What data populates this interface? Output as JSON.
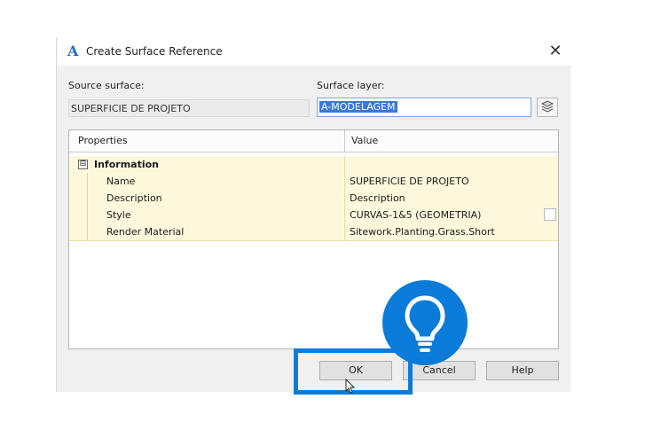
{
  "dialog": {
    "title": "Create Surface Reference",
    "app_icon": "autocad-civil3d-icon",
    "close_glyph": "✕"
  },
  "source_surface": {
    "label": "Source surface:",
    "value": "SUPERFICIE DE PROJETO"
  },
  "surface_layer": {
    "label": "Surface layer:",
    "value": "A-MODELAGEM",
    "button_icon": "layers-icon"
  },
  "properties_grid": {
    "headers": [
      "Properties",
      "Value"
    ],
    "category": {
      "name": "Information",
      "toggle": "⊟"
    },
    "rows": [
      {
        "property": "Name",
        "value": "SUPERFICIE DE PROJETO"
      },
      {
        "property": "Description",
        "value": "Description"
      },
      {
        "property": "Style",
        "value": "CURVAS-1&5 (GEOMETRIA)"
      },
      {
        "property": "Render Material",
        "value": "Sitework.Planting.Grass.Short"
      }
    ]
  },
  "buttons": {
    "ok": "OK",
    "cancel": "Cancel",
    "help": "Help"
  },
  "overlay": {
    "badge_icon": "lightbulb-icon",
    "accent_color": "#0a7bd8"
  }
}
